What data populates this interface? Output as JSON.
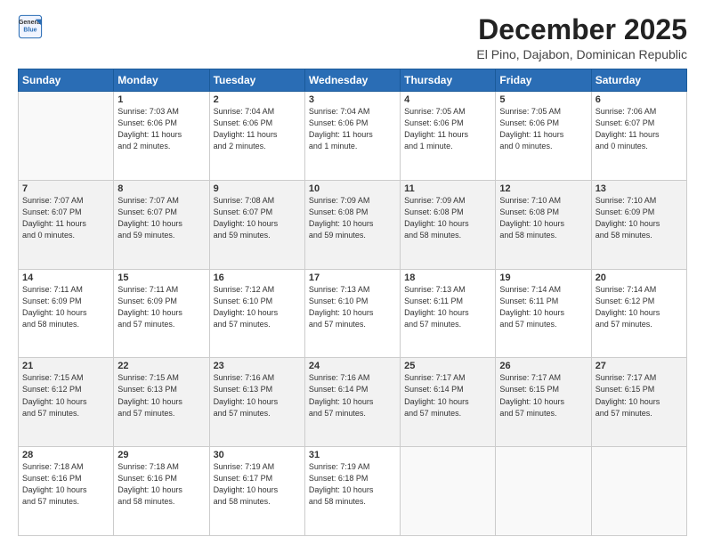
{
  "header": {
    "logo_line1": "General",
    "logo_line2": "Blue",
    "month_title": "December 2025",
    "location": "El Pino, Dajabon, Dominican Republic"
  },
  "weekdays": [
    "Sunday",
    "Monday",
    "Tuesday",
    "Wednesday",
    "Thursday",
    "Friday",
    "Saturday"
  ],
  "weeks": [
    [
      {
        "day": "",
        "info": ""
      },
      {
        "day": "1",
        "info": "Sunrise: 7:03 AM\nSunset: 6:06 PM\nDaylight: 11 hours\nand 2 minutes."
      },
      {
        "day": "2",
        "info": "Sunrise: 7:04 AM\nSunset: 6:06 PM\nDaylight: 11 hours\nand 2 minutes."
      },
      {
        "day": "3",
        "info": "Sunrise: 7:04 AM\nSunset: 6:06 PM\nDaylight: 11 hours\nand 1 minute."
      },
      {
        "day": "4",
        "info": "Sunrise: 7:05 AM\nSunset: 6:06 PM\nDaylight: 11 hours\nand 1 minute."
      },
      {
        "day": "5",
        "info": "Sunrise: 7:05 AM\nSunset: 6:06 PM\nDaylight: 11 hours\nand 0 minutes."
      },
      {
        "day": "6",
        "info": "Sunrise: 7:06 AM\nSunset: 6:07 PM\nDaylight: 11 hours\nand 0 minutes."
      }
    ],
    [
      {
        "day": "7",
        "info": "Sunrise: 7:07 AM\nSunset: 6:07 PM\nDaylight: 11 hours\nand 0 minutes."
      },
      {
        "day": "8",
        "info": "Sunrise: 7:07 AM\nSunset: 6:07 PM\nDaylight: 10 hours\nand 59 minutes."
      },
      {
        "day": "9",
        "info": "Sunrise: 7:08 AM\nSunset: 6:07 PM\nDaylight: 10 hours\nand 59 minutes."
      },
      {
        "day": "10",
        "info": "Sunrise: 7:09 AM\nSunset: 6:08 PM\nDaylight: 10 hours\nand 59 minutes."
      },
      {
        "day": "11",
        "info": "Sunrise: 7:09 AM\nSunset: 6:08 PM\nDaylight: 10 hours\nand 58 minutes."
      },
      {
        "day": "12",
        "info": "Sunrise: 7:10 AM\nSunset: 6:08 PM\nDaylight: 10 hours\nand 58 minutes."
      },
      {
        "day": "13",
        "info": "Sunrise: 7:10 AM\nSunset: 6:09 PM\nDaylight: 10 hours\nand 58 minutes."
      }
    ],
    [
      {
        "day": "14",
        "info": "Sunrise: 7:11 AM\nSunset: 6:09 PM\nDaylight: 10 hours\nand 58 minutes."
      },
      {
        "day": "15",
        "info": "Sunrise: 7:11 AM\nSunset: 6:09 PM\nDaylight: 10 hours\nand 57 minutes."
      },
      {
        "day": "16",
        "info": "Sunrise: 7:12 AM\nSunset: 6:10 PM\nDaylight: 10 hours\nand 57 minutes."
      },
      {
        "day": "17",
        "info": "Sunrise: 7:13 AM\nSunset: 6:10 PM\nDaylight: 10 hours\nand 57 minutes."
      },
      {
        "day": "18",
        "info": "Sunrise: 7:13 AM\nSunset: 6:11 PM\nDaylight: 10 hours\nand 57 minutes."
      },
      {
        "day": "19",
        "info": "Sunrise: 7:14 AM\nSunset: 6:11 PM\nDaylight: 10 hours\nand 57 minutes."
      },
      {
        "day": "20",
        "info": "Sunrise: 7:14 AM\nSunset: 6:12 PM\nDaylight: 10 hours\nand 57 minutes."
      }
    ],
    [
      {
        "day": "21",
        "info": "Sunrise: 7:15 AM\nSunset: 6:12 PM\nDaylight: 10 hours\nand 57 minutes."
      },
      {
        "day": "22",
        "info": "Sunrise: 7:15 AM\nSunset: 6:13 PM\nDaylight: 10 hours\nand 57 minutes."
      },
      {
        "day": "23",
        "info": "Sunrise: 7:16 AM\nSunset: 6:13 PM\nDaylight: 10 hours\nand 57 minutes."
      },
      {
        "day": "24",
        "info": "Sunrise: 7:16 AM\nSunset: 6:14 PM\nDaylight: 10 hours\nand 57 minutes."
      },
      {
        "day": "25",
        "info": "Sunrise: 7:17 AM\nSunset: 6:14 PM\nDaylight: 10 hours\nand 57 minutes."
      },
      {
        "day": "26",
        "info": "Sunrise: 7:17 AM\nSunset: 6:15 PM\nDaylight: 10 hours\nand 57 minutes."
      },
      {
        "day": "27",
        "info": "Sunrise: 7:17 AM\nSunset: 6:15 PM\nDaylight: 10 hours\nand 57 minutes."
      }
    ],
    [
      {
        "day": "28",
        "info": "Sunrise: 7:18 AM\nSunset: 6:16 PM\nDaylight: 10 hours\nand 57 minutes."
      },
      {
        "day": "29",
        "info": "Sunrise: 7:18 AM\nSunset: 6:16 PM\nDaylight: 10 hours\nand 58 minutes."
      },
      {
        "day": "30",
        "info": "Sunrise: 7:19 AM\nSunset: 6:17 PM\nDaylight: 10 hours\nand 58 minutes."
      },
      {
        "day": "31",
        "info": "Sunrise: 7:19 AM\nSunset: 6:18 PM\nDaylight: 10 hours\nand 58 minutes."
      },
      {
        "day": "",
        "info": ""
      },
      {
        "day": "",
        "info": ""
      },
      {
        "day": "",
        "info": ""
      }
    ]
  ]
}
